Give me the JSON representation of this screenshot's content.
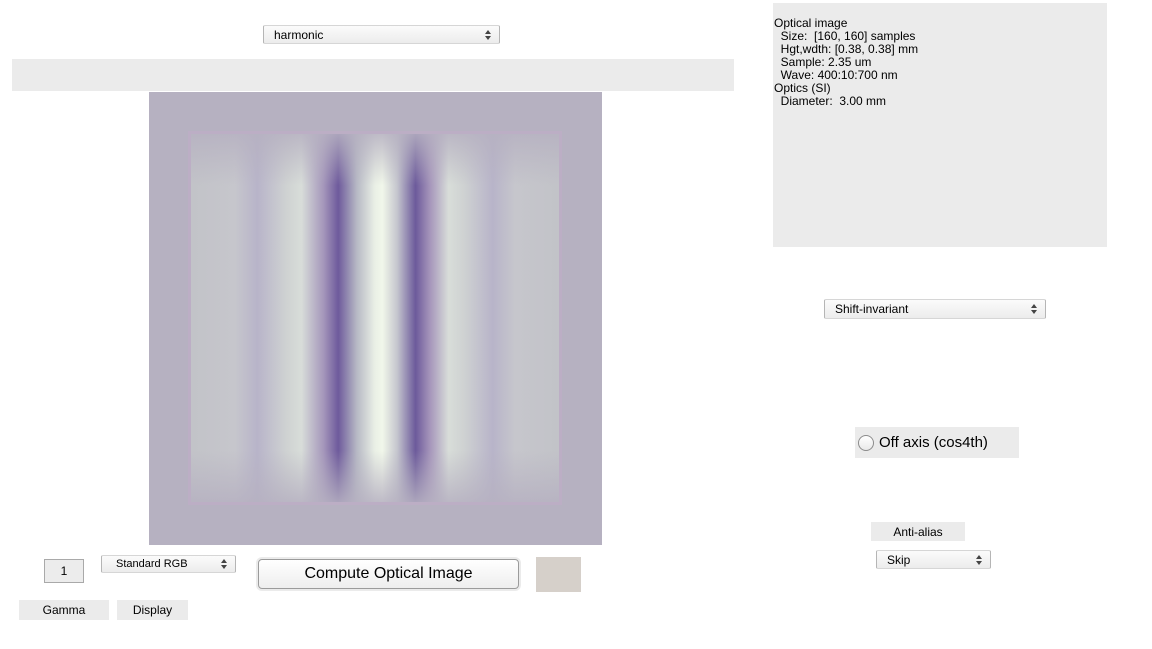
{
  "scene_popup": {
    "selected": "harmonic"
  },
  "image_panel": {
    "label": ""
  },
  "info": {
    "lines": [
      "Optical image",
      "  Size:  [160, 160] samples",
      "  Hgt,wdth: [0.38, 0.38] mm",
      "  Sample: 2.35 um",
      "  Wave: 400:10:700 nm",
      "Optics (SI)",
      "  Diameter:  3.00 mm"
    ]
  },
  "model_popup": {
    "selected": "Shift-invariant"
  },
  "off_axis": {
    "label": "Off axis (cos4th)",
    "checked": false
  },
  "anti_alias": {
    "label": "Anti-alias",
    "popup_selected": "Skip"
  },
  "controls": {
    "gamma_value": "1",
    "display_popup": "Standard RGB",
    "compute_label": "Compute Optical Image",
    "gamma_label": "Gamma",
    "display_label": "Display"
  }
}
